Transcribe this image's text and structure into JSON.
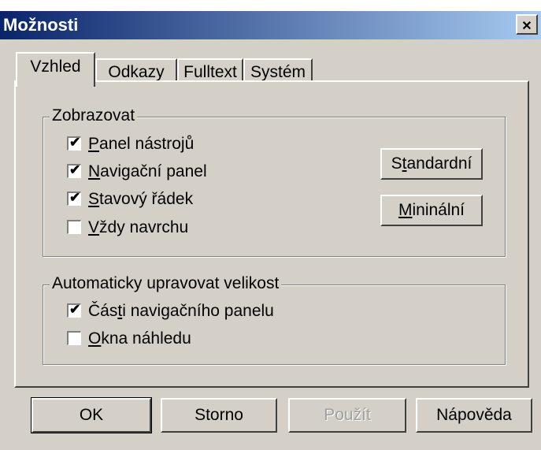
{
  "window": {
    "title": "Možnosti",
    "close_glyph": "✕"
  },
  "tabs": [
    {
      "label": "Vzhled",
      "active": true
    },
    {
      "label": "Odkazy",
      "active": false
    },
    {
      "label": "Fulltext",
      "active": false
    },
    {
      "label": "Systém",
      "active": false
    }
  ],
  "zobrazovat": {
    "title": "Zobrazovat",
    "items": [
      {
        "before": "",
        "accel": "P",
        "after": "anel nástrojů",
        "checked": true
      },
      {
        "before": "",
        "accel": "N",
        "after": "avigační panel",
        "checked": true
      },
      {
        "before": "",
        "accel": "S",
        "after": "tavový řádek",
        "checked": true
      },
      {
        "before": "",
        "accel": "V",
        "after": "ždy navrchu",
        "checked": false
      }
    ],
    "standard_button": {
      "before": "S",
      "accel": "t",
      "after": "andardní"
    },
    "minimal_button": {
      "before": "",
      "accel": "M",
      "after": "ininální"
    }
  },
  "autosize": {
    "title": "Automaticky upravovat velikost",
    "items": [
      {
        "before": "Čás",
        "accel": "t",
        "after": "i navigačního panelu",
        "checked": true
      },
      {
        "before": "",
        "accel": "O",
        "after": "kna náhledu",
        "checked": false
      }
    ]
  },
  "buttons": {
    "ok": "OK",
    "cancel": "Storno",
    "apply": "Použít",
    "help": "Nápověda"
  },
  "icons": {
    "check": "✔"
  }
}
